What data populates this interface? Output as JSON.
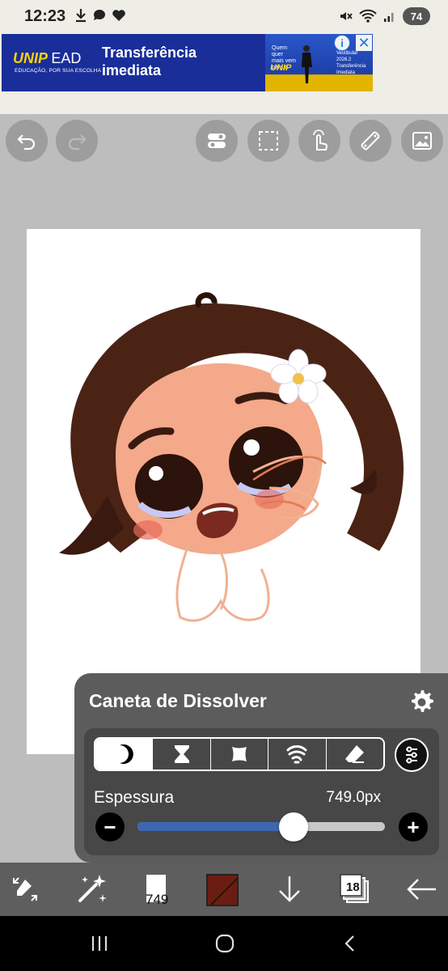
{
  "status_bar": {
    "time": "12:23",
    "battery": "74",
    "left_icons": [
      "download-icon",
      "chat-bubble-icon",
      "heart-icon"
    ],
    "right_icons": [
      "mute-icon",
      "wifi-icon",
      "signal-icon"
    ]
  },
  "ad": {
    "brand": "UNIP",
    "brand_suffix": "EAD",
    "tagline": "EDUCAÇÃO, POR SUA ESCOLHA",
    "headline_line1": "Transferência",
    "headline_line2": "imediata",
    "image_text": "Quem quer mais vem para a",
    "image_brand": "UNIP",
    "image_side_text": "Vestibular 2026.2 Transferência Imediata",
    "info_label": "i",
    "close_label": "✕",
    "colors": {
      "background": "#1a2e9a",
      "brand": "#ffd400"
    }
  },
  "toolbar": {
    "left": [
      "undo-icon",
      "redo-icon"
    ],
    "right": [
      "toggle-settings-icon",
      "selection-icon",
      "hand-gesture-icon",
      "ruler-icon",
      "image-import-icon"
    ]
  },
  "brush_panel": {
    "title": "Caneta de Dissolver",
    "modes": [
      "moon-icon",
      "hourglass-icon",
      "blob-icon",
      "wave-icon",
      "eraser-icon"
    ],
    "active_mode_index": 0,
    "thickness_label": "Espessura",
    "thickness_value": "749.0px",
    "thickness_fraction": 0.63,
    "minus_label": "−",
    "plus_label": "+",
    "colors": {
      "slider_fill": "#3e67b0",
      "panel": "#5c5c5c"
    }
  },
  "bottom_toolbar": {
    "items": [
      "transform-tool-icon",
      "magic-wand-icon",
      "brush-size-icon",
      "color-swatch",
      "move-down-icon",
      "layers-icon",
      "back-arrow-icon"
    ],
    "brush_size": "749",
    "layer_count": "18",
    "current_color": "#6b1d12"
  },
  "nav_bar": {
    "buttons": [
      "recent-apps-icon",
      "home-icon",
      "back-icon"
    ]
  }
}
